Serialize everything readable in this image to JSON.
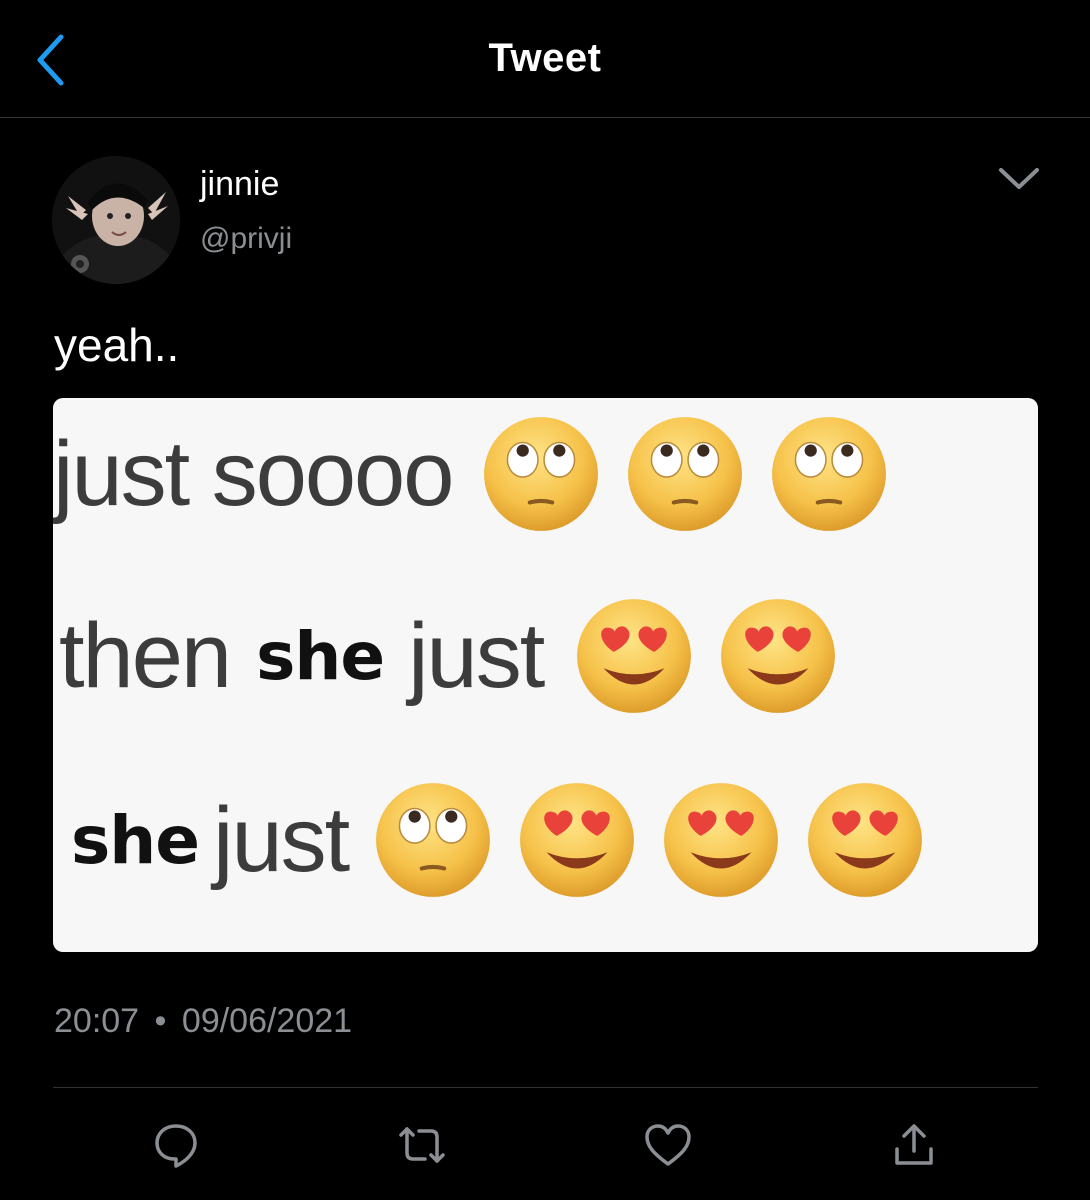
{
  "header": {
    "title": "Tweet",
    "back_icon": "chevron-left-icon"
  },
  "tweet": {
    "author": {
      "name": "jinnie",
      "handle": "@privji"
    },
    "text": "yeah..",
    "media": {
      "lines": [
        {
          "parts": [
            "just soooo"
          ],
          "emojis": [
            "face-with-rolling-eyes",
            "face-with-rolling-eyes",
            "face-with-rolling-eyes"
          ]
        },
        {
          "parts": [
            "then",
            "she",
            "just"
          ],
          "emojis": [
            "smiling-face-with-heart-eyes",
            "smiling-face-with-heart-eyes"
          ]
        },
        {
          "parts": [
            "she",
            "just"
          ],
          "emojis": [
            "face-with-rolling-eyes",
            "smiling-face-with-heart-eyes",
            "smiling-face-with-heart-eyes",
            "smiling-face-with-heart-eyes"
          ]
        }
      ]
    },
    "time": "20:07",
    "separator": "•",
    "date": "09/06/2021"
  },
  "actions": [
    {
      "name": "reply",
      "icon": "speech-bubble-icon"
    },
    {
      "name": "retweet",
      "icon": "retweet-icon"
    },
    {
      "name": "like",
      "icon": "heart-icon"
    },
    {
      "name": "share",
      "icon": "share-icon"
    }
  ],
  "colors": {
    "background": "#000000",
    "accent": "#1d9bf0",
    "secondary_text": "#8b8f94",
    "divider": "#2f3336",
    "meme_background": "#f7f7f7"
  }
}
